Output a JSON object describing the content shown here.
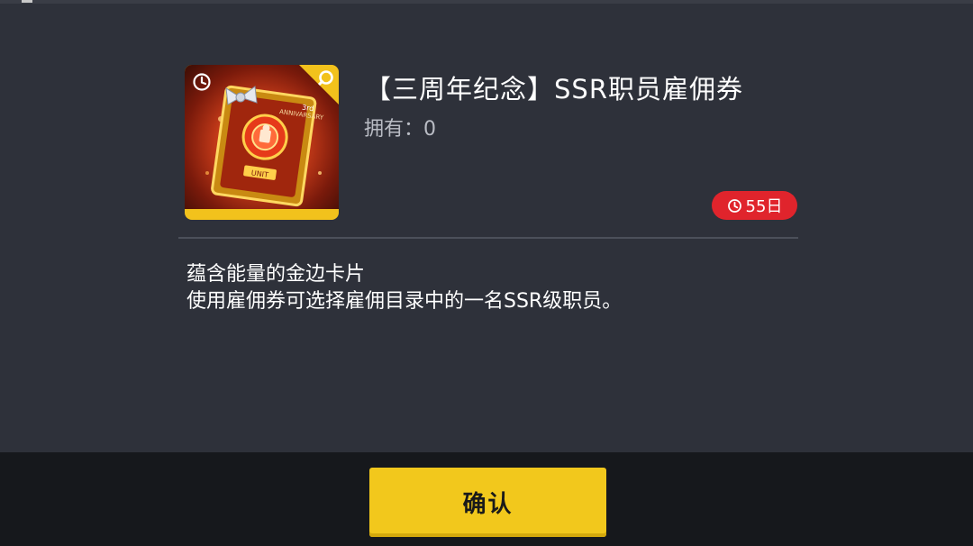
{
  "item": {
    "title": "【三周年纪念】SSR职员雇佣券",
    "owned_label": "拥有：",
    "owned_count": "0",
    "expiry": "55日",
    "card_art": {
      "badge_text": "3rd",
      "banner_text": "ANNIVARSARY",
      "unit_text": "UNIT",
      "primary_color": "#d2401b",
      "frame_color": "#f2c21c"
    }
  },
  "description": {
    "line1": "蕴含能量的金边卡片",
    "line2": "使用雇佣券可选择雇佣目录中的一名SSR级职员。"
  },
  "footer": {
    "confirm_label": "确认"
  },
  "colors": {
    "accent": "#f2c81c",
    "badge_red": "#e0242c",
    "panel": "#2e313a",
    "footer": "#16181c"
  },
  "icons": [
    "clock-icon",
    "search-icon",
    "timer-icon"
  ]
}
